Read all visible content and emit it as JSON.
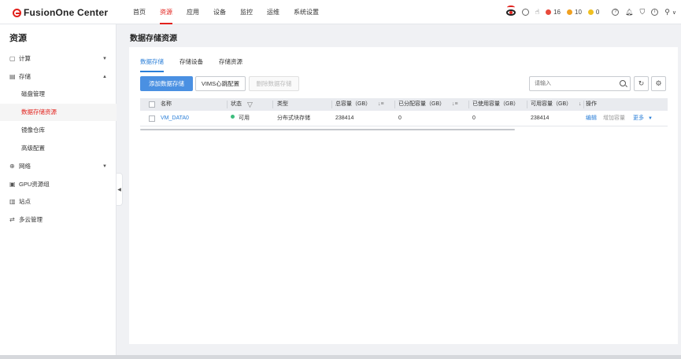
{
  "app": {
    "logo_text": "FusionOne Center"
  },
  "nav": {
    "items": [
      "首页",
      "资源",
      "应用",
      "设备",
      "监控",
      "运维",
      "系统设置"
    ],
    "active": "资源"
  },
  "top_right": {
    "critical_count": "16",
    "major_count": "10",
    "minor_count": "0",
    "colors": {
      "critical": "#e84a3c",
      "major": "#f0a020",
      "minor": "#f0c020"
    }
  },
  "sidebar": {
    "title": "资源",
    "items": [
      {
        "label": "计算",
        "icon": "cube-icon"
      },
      {
        "label": "存储",
        "icon": "storage-icon"
      },
      {
        "label": "磁盘管理"
      },
      {
        "label": "数据存储资源"
      },
      {
        "label": "镜像仓库"
      },
      {
        "label": "高级配置"
      },
      {
        "label": "网络",
        "icon": "globe-icon"
      },
      {
        "label": "GPU资源组",
        "icon": "gpu-icon"
      },
      {
        "label": "站点",
        "icon": "building-icon"
      },
      {
        "label": "多云管理",
        "icon": "cloud-icon"
      }
    ]
  },
  "main": {
    "title": "数据存储资源",
    "tabs": [
      "数据存储",
      "存储设备",
      "存储资源"
    ],
    "buttons": {
      "add": "添加数据存储",
      "vims": "VIMS心跳配置",
      "delete": "删除数据存储"
    },
    "search": {
      "placeholder": "请输入"
    },
    "table": {
      "headers": [
        "名称",
        "状态",
        "类型",
        "总容量（GB）",
        "已分配容量（GB）",
        "已使用容量（GB）",
        "可用容量（GB）",
        "操作"
      ],
      "rows": [
        {
          "name": "VM_DATA0",
          "status": "可用",
          "type": "分布式块存储",
          "total": "238414",
          "allocated": "0",
          "used": "0",
          "available": "238414",
          "actions": [
            "编辑",
            "增加容量",
            "更多"
          ]
        }
      ]
    }
  }
}
